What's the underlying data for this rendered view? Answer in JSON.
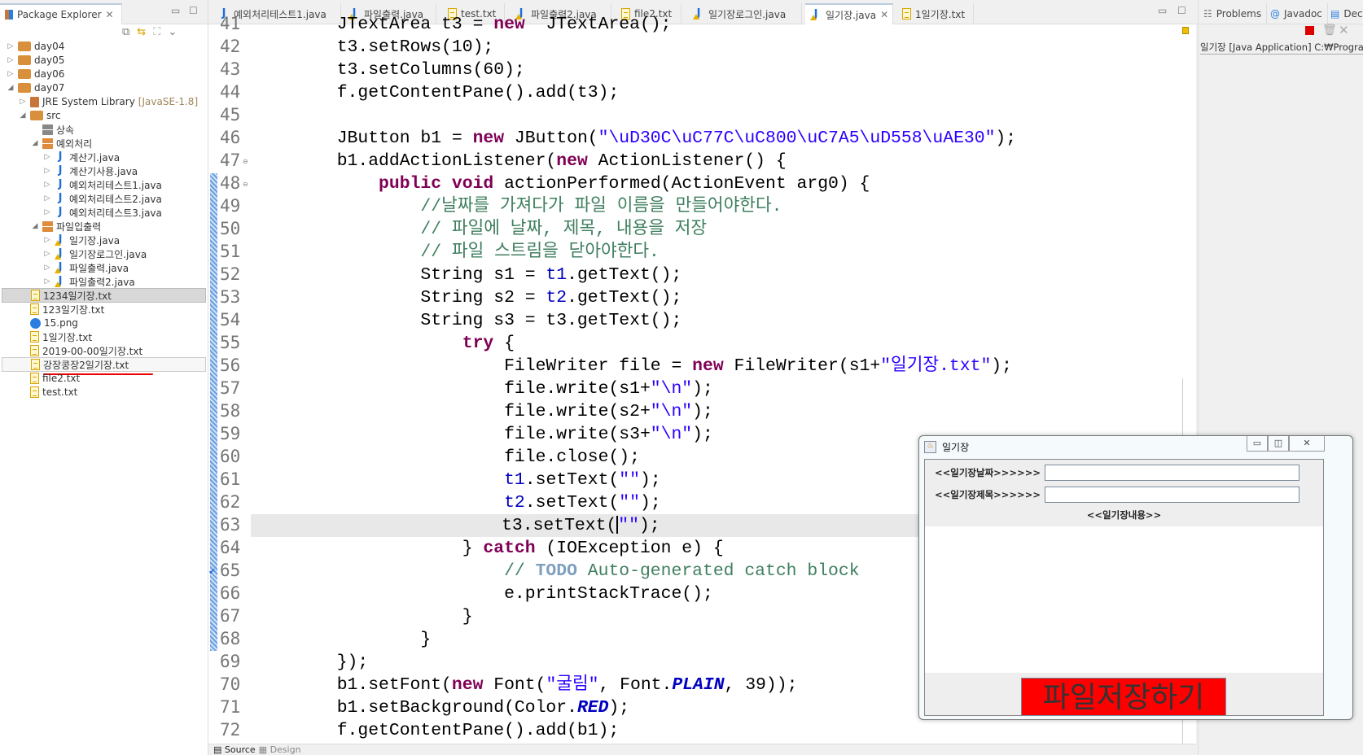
{
  "explorer": {
    "title": "Package Explorer",
    "tree": [
      {
        "label": "day04",
        "icon": "project-folder-icon",
        "arrow": "▷",
        "indent": 0
      },
      {
        "label": "day05",
        "icon": "project-folder-icon",
        "arrow": "▷",
        "indent": 0
      },
      {
        "label": "day06",
        "icon": "project-folder-icon",
        "arrow": "▷",
        "indent": 0
      },
      {
        "label": "day07",
        "icon": "project-folder-icon",
        "arrow": "◢",
        "indent": 0
      },
      {
        "label": "JRE System Library",
        "suffix": "[JavaSE-1.8]",
        "icon": "library-icon",
        "arrow": "▷",
        "indent": 1
      },
      {
        "label": "src",
        "icon": "source-folder-icon",
        "arrow": "◢",
        "indent": 1
      },
      {
        "label": "상속",
        "icon": "package-empty-icon",
        "arrow": "",
        "indent": 2
      },
      {
        "label": "예외처리",
        "icon": "package-icon",
        "arrow": "◢",
        "indent": 2
      },
      {
        "label": "계산기.java",
        "icon": "java-file-icon",
        "arrow": "▷",
        "indent": 3
      },
      {
        "label": "계산기사용.java",
        "icon": "java-file-icon",
        "arrow": "▷",
        "indent": 3
      },
      {
        "label": "예외처리테스트1.java",
        "icon": "java-file-icon",
        "arrow": "▷",
        "indent": 3
      },
      {
        "label": "예외처리테스트2.java",
        "icon": "java-file-icon",
        "arrow": "▷",
        "indent": 3
      },
      {
        "label": "예외처리테스트3.java",
        "icon": "java-file-icon",
        "arrow": "▷",
        "indent": 3
      },
      {
        "label": "파일입출력",
        "icon": "package-icon",
        "arrow": "◢",
        "indent": 2
      },
      {
        "label": "일기장.java",
        "icon": "java-warning-icon",
        "arrow": "▷",
        "indent": 3
      },
      {
        "label": "일기장로그인.java",
        "icon": "java-warning-icon",
        "arrow": "▷",
        "indent": 3
      },
      {
        "label": "파일출력.java",
        "icon": "java-warning-icon",
        "arrow": "▷",
        "indent": 3
      },
      {
        "label": "파일출력2.java",
        "icon": "java-warning-icon",
        "arrow": "▷",
        "indent": 3
      },
      {
        "label": "1234일기장.txt",
        "icon": "text-file-icon",
        "arrow": "",
        "indent": 1,
        "state": "selected"
      },
      {
        "label": "123일기장.txt",
        "icon": "text-file-icon",
        "arrow": "",
        "indent": 1
      },
      {
        "label": "15.png",
        "icon": "image-file-icon",
        "arrow": "",
        "indent": 1
      },
      {
        "label": "1일기장.txt",
        "icon": "text-file-icon",
        "arrow": "",
        "indent": 1
      },
      {
        "label": "2019-00-00일기장.txt",
        "icon": "text-file-icon",
        "arrow": "",
        "indent": 1
      },
      {
        "label": "강장콩장2일기장.txt",
        "icon": "text-file-icon",
        "arrow": "",
        "indent": 1,
        "state": "hover",
        "underline": true
      },
      {
        "label": "file2.txt",
        "icon": "text-file-icon",
        "arrow": "",
        "indent": 1
      },
      {
        "label": "test.txt",
        "icon": "text-file-icon",
        "arrow": "",
        "indent": 1
      }
    ]
  },
  "editor": {
    "tabs": [
      {
        "label": "예외처리테스트1.java",
        "icon": "java-file-icon"
      },
      {
        "label": "파일출력.java",
        "icon": "java-warning-icon"
      },
      {
        "label": "test.txt",
        "icon": "text-file-icon"
      },
      {
        "label": "파일출력2.java",
        "icon": "java-warning-icon"
      },
      {
        "label": "file2.txt",
        "icon": "text-file-icon"
      },
      {
        "label": "일기장로그인.java",
        "icon": "java-warning-icon"
      },
      {
        "label": "일기장.java",
        "icon": "java-warning-icon",
        "active": true
      },
      {
        "label": "1일기장.txt",
        "icon": "text-file-icon"
      }
    ],
    "first_line": 41,
    "current_line": 63,
    "lines": [
      [
        [
          "",
          "        JTextArea t3 = "
        ],
        [
          "kw",
          "new"
        ],
        [
          "",
          "  JTextArea();"
        ]
      ],
      [
        [
          "",
          "        t3.setRows(10);"
        ]
      ],
      [
        [
          "",
          "        t3.setColumns(60);"
        ]
      ],
      [
        [
          "",
          "        f.getContentPane().add(t3);"
        ]
      ],
      [],
      [
        [
          "",
          "        JButton b1 = "
        ],
        [
          "kw",
          "new"
        ],
        [
          "",
          " JButton("
        ],
        [
          "str",
          "\"\\uD30C\\uC77C\\uC800\\uC7A5\\uD558\\uAE30\""
        ],
        [
          "",
          ");"
        ]
      ],
      [
        [
          "",
          "        b1.addActionListener("
        ],
        [
          "kw",
          "new"
        ],
        [
          "",
          " ActionListener() {"
        ]
      ],
      [
        [
          "",
          "            "
        ],
        [
          "kw",
          "public"
        ],
        [
          "",
          " "
        ],
        [
          "kw",
          "void"
        ],
        [
          "",
          " actionPerformed(ActionEvent arg0) {"
        ]
      ],
      [
        [
          "",
          "                "
        ],
        [
          "cmt",
          "//날짜를 가져다가 파일 이름을 만들어야한다."
        ]
      ],
      [
        [
          "",
          "                "
        ],
        [
          "cmt",
          "// 파일에 날짜, 제목, 내용을 저장"
        ]
      ],
      [
        [
          "",
          "                "
        ],
        [
          "cmt",
          "// 파일 스트림을 닫아야한다."
        ]
      ],
      [
        [
          "",
          "                String s1 = "
        ],
        [
          "fld",
          "t1"
        ],
        [
          "",
          ".getText();"
        ]
      ],
      [
        [
          "",
          "                String s2 = "
        ],
        [
          "fld",
          "t2"
        ],
        [
          "",
          ".getText();"
        ]
      ],
      [
        [
          "",
          "                String s3 = t3.getText();"
        ]
      ],
      [
        [
          "",
          "                    "
        ],
        [
          "kw",
          "try"
        ],
        [
          "",
          " {"
        ]
      ],
      [
        [
          "",
          "                        FileWriter file = "
        ],
        [
          "kw",
          "new"
        ],
        [
          "",
          " FileWriter(s1+"
        ],
        [
          "str",
          "\"일기장.txt\""
        ],
        [
          "",
          ");"
        ]
      ],
      [
        [
          "",
          "                        file.write(s1+"
        ],
        [
          "str",
          "\"\\n\""
        ],
        [
          "",
          ");"
        ]
      ],
      [
        [
          "",
          "                        file.write(s2+"
        ],
        [
          "str",
          "\"\\n\""
        ],
        [
          "",
          ");"
        ]
      ],
      [
        [
          "",
          "                        file.write(s3+"
        ],
        [
          "str",
          "\"\\n\""
        ],
        [
          "",
          ");"
        ]
      ],
      [
        [
          "",
          "                        file.close();"
        ]
      ],
      [
        [
          "",
          "                        "
        ],
        [
          "fld",
          "t1"
        ],
        [
          "",
          ".setText("
        ],
        [
          "str",
          "\"\""
        ],
        [
          "",
          ");"
        ]
      ],
      [
        [
          "",
          "                        "
        ],
        [
          "fld",
          "t2"
        ],
        [
          "",
          ".setText("
        ],
        [
          "str",
          "\"\""
        ],
        [
          "",
          ");"
        ]
      ],
      [
        [
          "",
          "                        t3.setText("
        ],
        [
          "cursor",
          ""
        ],
        [
          "str",
          "\"\""
        ],
        [
          "",
          ");"
        ]
      ],
      [
        [
          "",
          "                    } "
        ],
        [
          "kw",
          "catch"
        ],
        [
          "",
          " (IOException e) {"
        ]
      ],
      [
        [
          "",
          "                        "
        ],
        [
          "cmt",
          "// "
        ],
        [
          "todo",
          "TODO"
        ],
        [
          "cmt",
          " Auto-generated catch block"
        ]
      ],
      [
        [
          "",
          "                        e.printStackTrace();"
        ]
      ],
      [
        [
          "",
          "                    }"
        ]
      ],
      [
        [
          "",
          "                }"
        ]
      ],
      [
        [
          "",
          "        });"
        ]
      ],
      [
        [
          "",
          "        b1.setFont("
        ],
        [
          "kw",
          "new"
        ],
        [
          "",
          " Font("
        ],
        [
          "str",
          "\"굴림\""
        ],
        [
          "",
          ", Font."
        ],
        [
          "cst",
          "PLAIN"
        ],
        [
          "",
          ", 39));"
        ]
      ],
      [
        [
          "",
          "        b1.setBackground(Color."
        ],
        [
          "cst",
          "RED"
        ],
        [
          "",
          ");"
        ]
      ],
      [
        [
          "",
          "        f.getContentPane().add(b1);"
        ]
      ]
    ],
    "bottom_tabs": [
      "Source",
      "Design"
    ]
  },
  "right": {
    "tabs": [
      "Problems",
      "Javadoc",
      "Decla"
    ],
    "console_text": "일기장 [Java Application] C:₩Program"
  },
  "dialog": {
    "title": "일기장",
    "date_label": "<<일기장날짜>>>>>>",
    "date_value": "",
    "title_label": "<<일기장제목>>>>>>",
    "title_value": "",
    "content_label": "<<일기장내용>>",
    "content_value": "",
    "save_button": "파일저장하기",
    "button_color": "#ff0000"
  }
}
